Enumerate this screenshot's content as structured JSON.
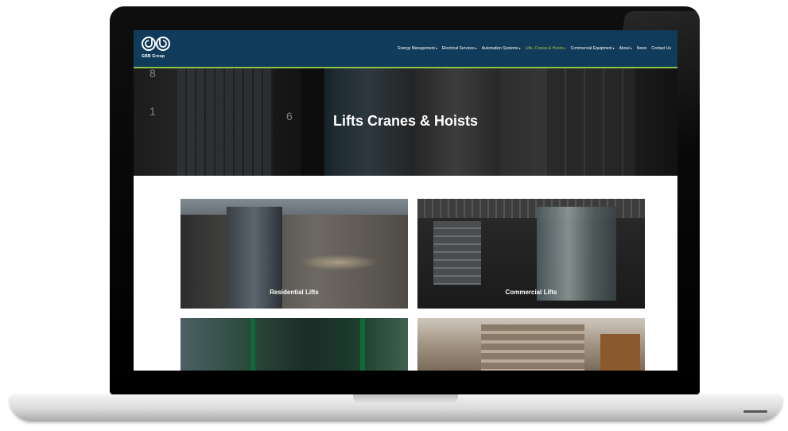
{
  "brand": {
    "logo_text": "GBB Group"
  },
  "nav": {
    "items": [
      {
        "label": "Energy Management",
        "has_caret": true,
        "active": false
      },
      {
        "label": "Electrical Services",
        "has_caret": true,
        "active": false
      },
      {
        "label": "Automation Systems",
        "has_caret": true,
        "active": false
      },
      {
        "label": "Lifts, Cranes & Hoists",
        "has_caret": true,
        "active": true
      },
      {
        "label": "Commercial Equipment",
        "has_caret": true,
        "active": false
      },
      {
        "label": "About",
        "has_caret": true,
        "active": false
      },
      {
        "label": "News",
        "has_caret": false,
        "active": false
      },
      {
        "label": "Contact Us",
        "has_caret": false,
        "active": false
      }
    ],
    "caret_glyph": "▾"
  },
  "hero": {
    "title": "Lifts Cranes & Hoists",
    "floor_numbers": [
      "8",
      "1",
      "6"
    ]
  },
  "cards": [
    {
      "label": "Residential Lifts"
    },
    {
      "label": "Commercial Lifts"
    },
    {
      "label": ""
    },
    {
      "label": ""
    }
  ],
  "colors": {
    "header_bg": "#113b5a",
    "accent_green": "#8bc34a",
    "active_nav": "#9ccc3c"
  }
}
